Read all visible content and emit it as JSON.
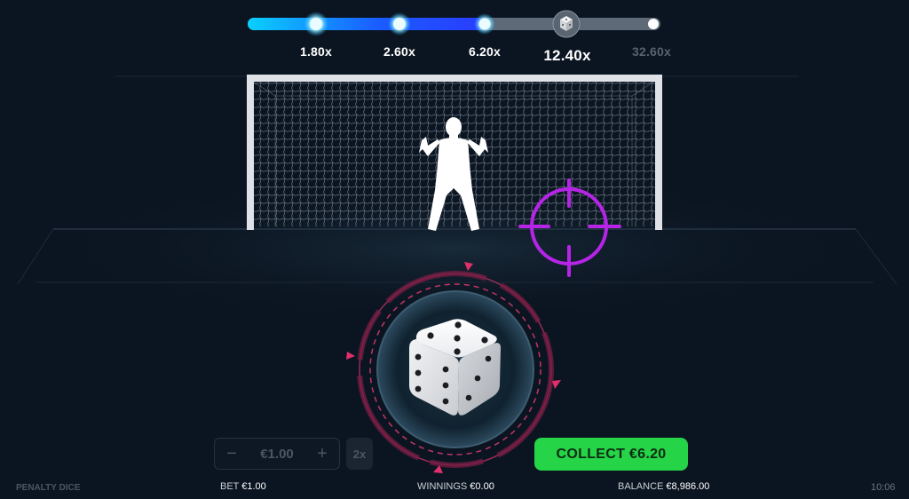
{
  "progress": {
    "multipliers": [
      {
        "label": "1.80x",
        "state": "done"
      },
      {
        "label": "2.60x",
        "state": "done"
      },
      {
        "label": "6.20x",
        "state": "done"
      },
      {
        "label": "12.40x",
        "state": "current"
      },
      {
        "label": "32.60x",
        "state": "future"
      }
    ],
    "current_icon": "dice-icon"
  },
  "dice": {
    "top_face": 5,
    "front_face": 6,
    "right_face": 3
  },
  "controls": {
    "minus_label": "−",
    "bet_value": "€1.00",
    "plus_label": "+",
    "double_label": "2x",
    "collect_label": "COLLECT €6.20"
  },
  "footer": {
    "brand": "PENALTY DICE",
    "bet_label": "BET",
    "bet_value": "€1.00",
    "winnings_label": "WINNINGS",
    "winnings_value": "€0.00",
    "balance_label": "BALANCE",
    "balance_value": "€8,986.00",
    "clock": "10:06"
  },
  "colors": {
    "accent_blue": "#1e5bff",
    "crosshair": "#b624e8",
    "collect_green": "#25d447",
    "ring_red": "#e0306a"
  }
}
